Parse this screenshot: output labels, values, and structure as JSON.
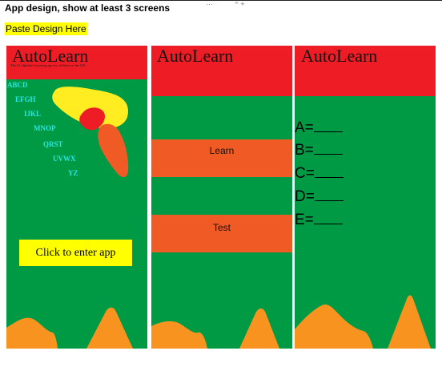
{
  "page": {
    "heading": "App design, show at least 3 screens",
    "highlight_label": "Paste Design Here",
    "toolbar_dots": "···",
    "toolbar_icons": "⁼ +"
  },
  "screen1": {
    "brand": "AutoLearn",
    "tagline": "The #1 alphabet learning app for children in the UK",
    "letter_groups": [
      "ABCD",
      "EFGH",
      "IJKL",
      "MNOP",
      "QRST",
      "UVWX",
      "YZ"
    ],
    "enter_label": "Click to enter app"
  },
  "screen2": {
    "brand": "AutoLearn",
    "learn_label": "Learn",
    "test_label": "Test"
  },
  "screen3": {
    "brand": "AutoLearn",
    "answers": [
      "A=",
      "B=",
      "C=",
      "D=",
      "E="
    ]
  },
  "colors": {
    "background": "#009944",
    "header": "#ee1c25",
    "button": "#f05a24",
    "highlight": "#ffff00",
    "letters": "#29e6e6",
    "hills": "#f7931e"
  }
}
